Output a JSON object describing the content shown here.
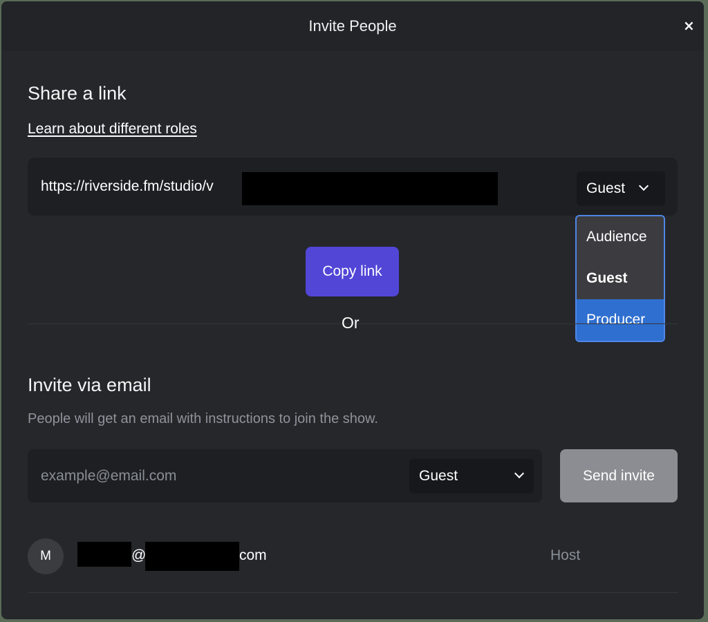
{
  "dialog": {
    "title": "Invite People",
    "close_label": "×"
  },
  "share_link": {
    "heading": "Share a link",
    "roles_link": "Learn about different roles",
    "url": "https://riverside.fm/studio/v",
    "selected_role": "Guest",
    "dropdown_options": [
      "Audience",
      "Guest",
      "Producer"
    ],
    "copy_button": "Copy link"
  },
  "separator_text": "Or",
  "invite_email": {
    "heading": "Invite via email",
    "description": "People will get an email with instructions to join the show.",
    "placeholder": "example@email.com",
    "selected_role": "Guest",
    "send_button": "Send invite"
  },
  "members": [
    {
      "initial": "M",
      "email_at": "@",
      "email_suffix": "com",
      "role": "Host"
    }
  ],
  "colors": {
    "accent": "#5146d6",
    "dropdown_highlight": "#2f6fd0",
    "dropdown_border": "#4f86e8",
    "send_disabled": "#8b8d92"
  }
}
